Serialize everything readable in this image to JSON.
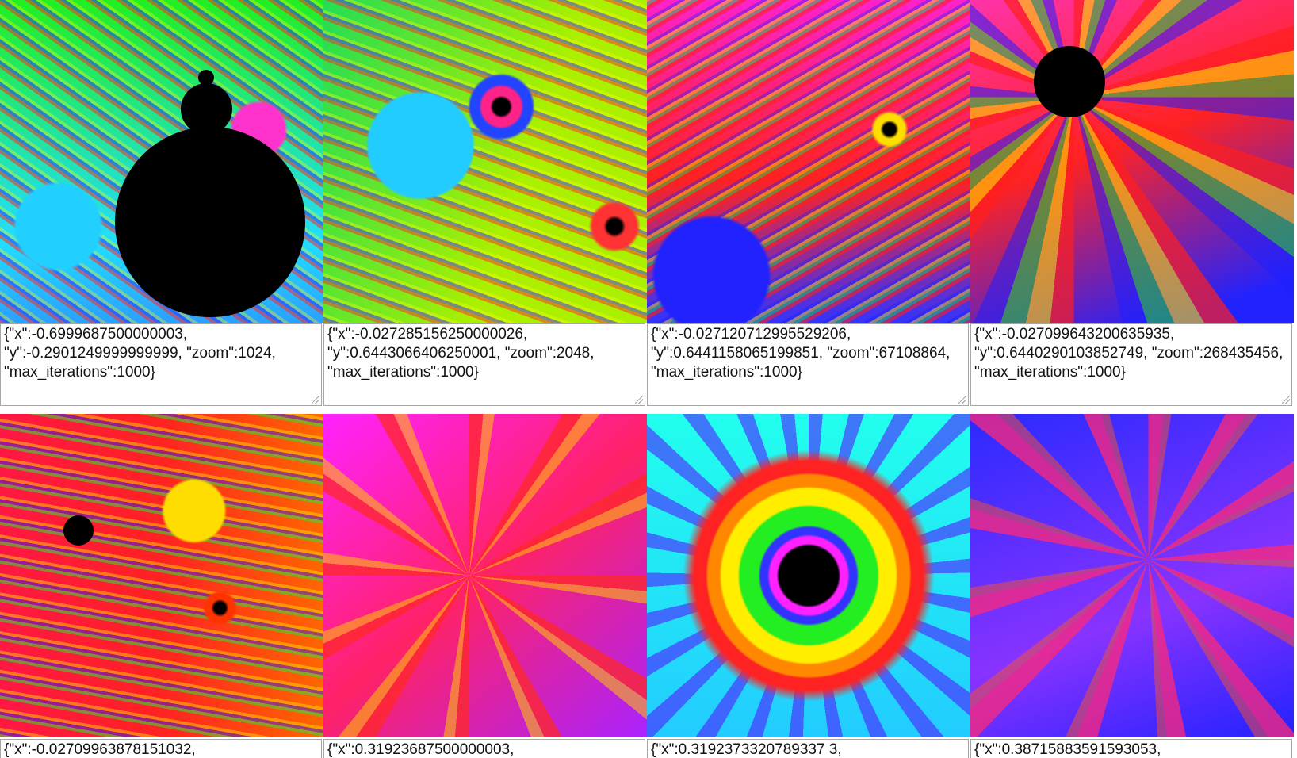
{
  "tiles": [
    {
      "caption": "{\"x\":-0.6999687500000003, \"y\":-0.2901249999999999, \"zoom\":1024, \"max_iterations\":1000}",
      "base": "#22ee22",
      "accent": "#33ddff"
    },
    {
      "caption": "{\"x\":-0.027285156250000026, \"y\":0.6443066406250001, \"zoom\":2048, \"max_iterations\":1000}",
      "base": "#aaf000",
      "accent": "#22ccff"
    },
    {
      "caption": "{\"x\":-0.027120712995529206, \"y\":0.6441158065199851, \"zoom\":67108864, \"max_iterations\":1000}",
      "base": "#ff22cc",
      "accent": "#3333ff"
    },
    {
      "caption": "{\"x\":-0.027099643200635935, \"y\":0.6440290103852749, \"zoom\":268435456, \"max_iterations\":1000}",
      "base": "#ff33aa",
      "accent": "#2222ff"
    },
    {
      "caption": "{\"x\":-0.02709963878151032,",
      "base": "#ff1744",
      "accent": "#ffcc00"
    },
    {
      "caption": "{\"x\":0.31923687500000003,",
      "base": "#ff22ff",
      "accent": "#ff2222"
    },
    {
      "caption": "{\"x\":0.3192373320789337 3,",
      "base": "#22ffee",
      "accent": "#1111ff"
    },
    {
      "caption": "{\"x\":0.38715883591593053,",
      "base": "#2a2aff",
      "accent": "#ff2288"
    }
  ]
}
